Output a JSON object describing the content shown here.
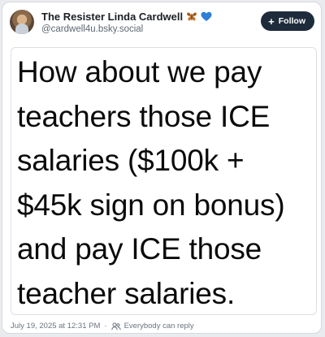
{
  "author": {
    "display_name": "The Resister Linda Cardwell",
    "handle": "@cardwell4u.bsky.social",
    "name_emojis": [
      "butterfly-emoji",
      "blue-heart-emoji"
    ]
  },
  "follow_button": {
    "label": "Follow",
    "icon": "plus-icon",
    "bg_color": "#1e2b3a"
  },
  "post": {
    "image_text_lines": [
      "How about we pay",
      "teachers those ICE",
      "salaries ($100k +",
      "$45k sign on bonus)",
      "and pay ICE those",
      "teacher salaries."
    ]
  },
  "footer": {
    "timestamp": "July 19, 2025 at 12:31 PM",
    "separator": "·",
    "reply_setting_icon": "people-icon",
    "reply_setting": "Everybody can reply"
  }
}
